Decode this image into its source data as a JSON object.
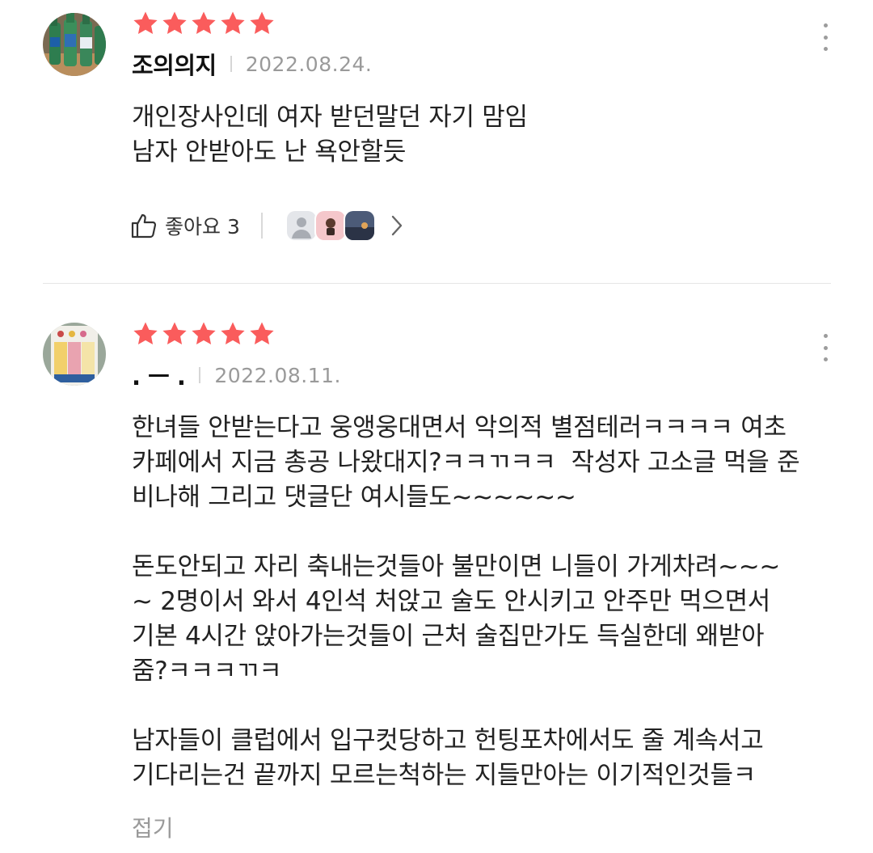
{
  "reviews": [
    {
      "rating": 5,
      "nickname": "조의의지",
      "date": "2022.08.24.",
      "text": "개인장사인데 여자 받던말던 자기 맘임\n남자 안받아도 난 욕안할듯",
      "like_label": "좋아요 3",
      "avatar_icon": "soju-bottles-photo"
    },
    {
      "rating": 5,
      "nickname": ". ㅡ .",
      "date": "2022.08.11.",
      "text": "한녀들 안받는다고 웅앵웅대면서 악의적 별점테러ㅋㅋㅋㅋ 여초\n카페에서 지금 총공 나왔대지?ㅋㅋㄲㅋㅋ  작성자 고소글 먹을 준\n비나해 그리고 댓글단 여시들도~~~~~~\n\n돈도안되고 자리 축내는것들아 불만이면 니들이 가게차려~~~\n~ 2명이서 와서 4인석 처앉고 술도 안시키고 안주만 먹으면서\n기본 4시간 앉아가는것들이 근처 술집만가도 득실한데 왜받아\n줌?ㅋㅋㅋㄲㅋ\n\n남자들이 클럽에서 입구컷당하고 헌팅포차에서도 줄 계속서고\n기다리는건 끝까지 모르는척하는 지들만아는 이기적인것들ㅋ",
      "collapse_label": "접기",
      "avatar_icon": "snack-package-photo"
    }
  ],
  "colors": {
    "star": "#fa5c5c",
    "date": "#9a9a9a",
    "divider": "#e6e6e6"
  }
}
